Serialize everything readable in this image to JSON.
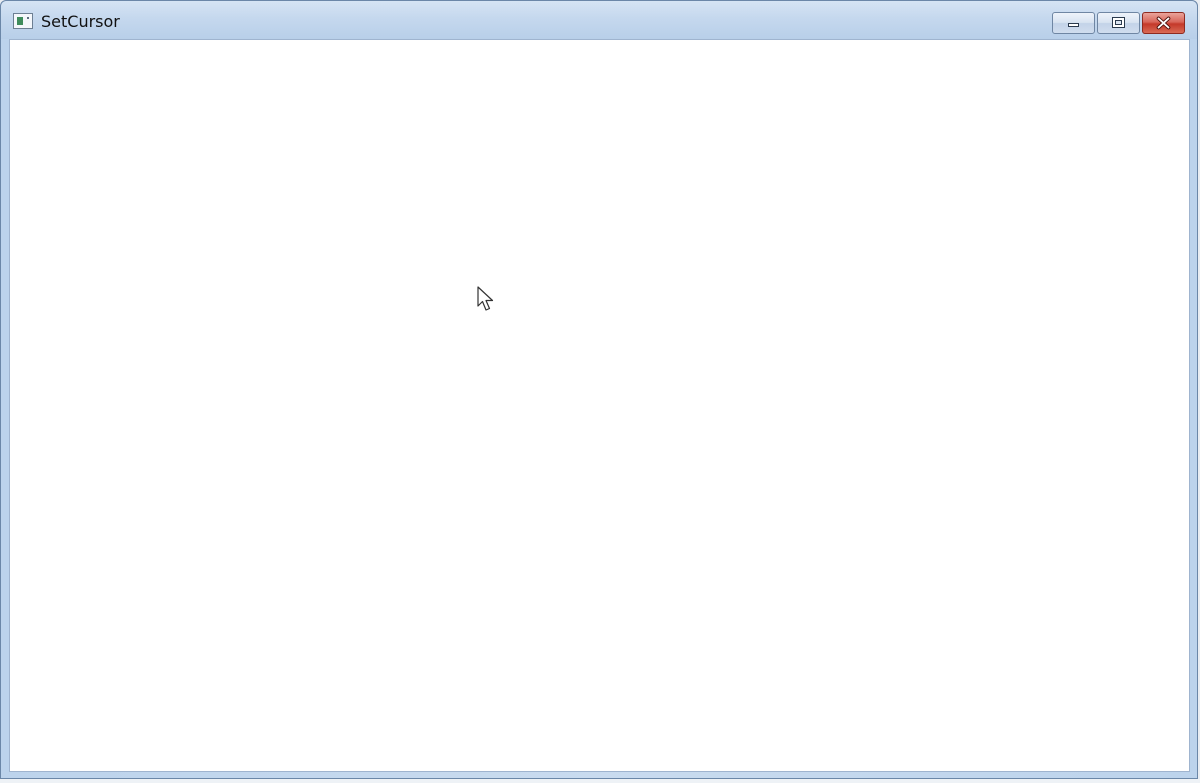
{
  "window": {
    "title": "SetCursor",
    "icons": {
      "app": "window-app-icon",
      "minimize": "minimize-icon",
      "maximize": "restore-icon",
      "close": "close-icon",
      "cursor": "arrow-cursor-icon"
    },
    "colors": {
      "titlebar": "#c5d8ee",
      "client_background": "#ffffff",
      "close_button": "#c4392a"
    }
  }
}
